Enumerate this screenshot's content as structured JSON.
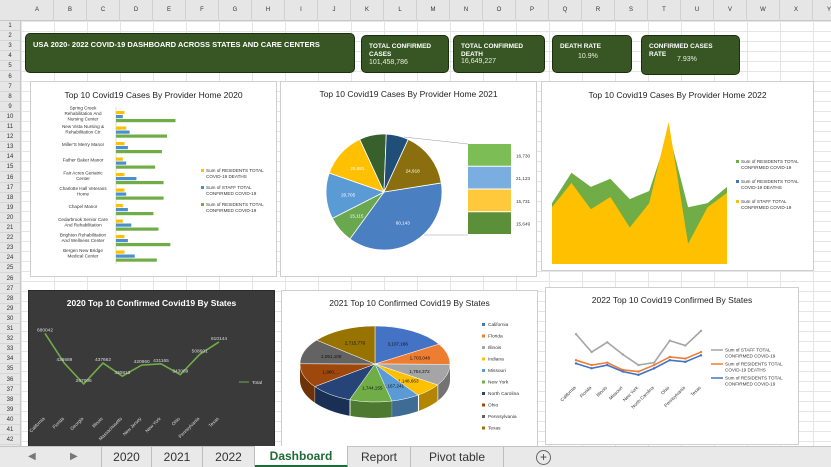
{
  "columns": [
    "A",
    "B",
    "C",
    "D",
    "E",
    "F",
    "G",
    "H",
    "I",
    "J",
    "K",
    "L",
    "M",
    "N",
    "O",
    "P",
    "Q",
    "R",
    "S",
    "T",
    "U",
    "V",
    "W",
    "X",
    "Y"
  ],
  "rows": [
    "1",
    "2",
    "3",
    "4",
    "5",
    "6",
    "7",
    "8",
    "9",
    "10",
    "11",
    "12",
    "13",
    "14",
    "15",
    "16",
    "17",
    "18",
    "19",
    "20",
    "21",
    "22",
    "23",
    "24",
    "25",
    "26",
    "27",
    "28",
    "29",
    "30",
    "31",
    "32",
    "33",
    "34",
    "35",
    "36",
    "37",
    "38",
    "39",
    "40",
    "41",
    "42"
  ],
  "banner": {
    "title": "USA 2020- 2022 COVID-19 DASHBOARD ACROSS STATES AND CARE CENTERS"
  },
  "kpis": [
    {
      "label": "TOTAL  CONFIRMED CASES",
      "value": "101,458,786"
    },
    {
      "label": "TOTAL  CONFIRMED DEATH",
      "value": "16,649,227"
    },
    {
      "label": "DEATH RATE",
      "value": "10.9%"
    },
    {
      "label": "CONFIRMED CASES RATE",
      "value": "7.93%"
    }
  ],
  "panels": {
    "p2020": {
      "title": "Top 10 Covid19 Cases By Provider Home 2020"
    },
    "p2021": {
      "title": "Top 10 Covid19 Cases By Provider Home 2021"
    },
    "p2022": {
      "title": "Top 10 Covid19 Cases By Provider Home 2022"
    },
    "s2020": {
      "title": "2020 Top 10 Confirmed Covid19 By States"
    },
    "s2021": {
      "title": "2021 Top 10 Confirmed Covid19 By States"
    },
    "s2022": {
      "title": "2022 Top 10 Covid19 Confirmed By States"
    }
  },
  "chart_data": [
    {
      "type": "bar",
      "title": "Top 10 Covid19 Cases By Provider Home 2020",
      "categories": [
        "Spring Creek Rehabilitation And Nursing Center",
        "New Vista Nursing & Rehabilitation Ctr",
        "Miller'S Merry Manor",
        "Father Baker Manor",
        "Fair Acres Geriatric Center",
        "Charlotte Hall Veterans Home",
        "Chapel Manor",
        "Cedarbrook Senior Care And Rehabilitation",
        "Brighton Rehabilitation And Wellness Center",
        "Bergen New Bridge Medical Center"
      ],
      "series": [
        {
          "name": "Sum of RESIDENTS  TOTAL COVID-19 DEATHS",
          "color": "#ffc000",
          "values": [
            5,
            6,
            5,
            4,
            5,
            5,
            4,
            4,
            5,
            5
          ]
        },
        {
          "name": "Sum of STAFF  TOTAL CONFIRMED COVID-19",
          "color": "#4a90d0",
          "values": [
            4,
            8,
            7,
            6,
            12,
            6,
            7,
            9,
            7,
            11
          ]
        },
        {
          "name": "Sum of RESIDENTS TOTAL CONFIRMED COVID-19",
          "color": "#70ad47",
          "values": [
            35,
            30,
            27,
            23,
            28,
            28,
            22,
            25,
            32,
            24
          ]
        }
      ]
    },
    {
      "type": "pie",
      "title": "Top 10 Covid19 Cases By Provider Home 2021",
      "slices": [
        {
          "value": 60000,
          "color": "#4a7fc1",
          "label": "60,143"
        },
        {
          "value": 12000,
          "color": "#6aa84f",
          "label": "15,115"
        },
        {
          "value": 20500,
          "color": "#5b9bd5",
          "label": "20,705"
        },
        {
          "value": 20500,
          "color": "#ffc000",
          "label": "20,681"
        },
        {
          "value": 12000,
          "color": "#38602c",
          "label": ""
        },
        {
          "value": 10000,
          "color": "#1f4e79",
          "label": ""
        },
        {
          "value": 25000,
          "color": "#8b6f0e",
          "label": "24,918"
        }
      ],
      "breakout": [
        {
          "value": 16730,
          "color": "#7cbd55",
          "label": "16,730"
        },
        {
          "value": 21123,
          "color": "#7aaee0",
          "label": "21,123"
        },
        {
          "value": 15731,
          "color": "#ffc93b",
          "label": "15,731"
        },
        {
          "value": 15649,
          "color": "#5b8f3a",
          "label": "15,649"
        }
      ]
    },
    {
      "type": "area",
      "title": "Top 10 Covid19 Cases By Provider Home 2022",
      "series": [
        {
          "name": "Sum of RESIDENTS TOTAL CONFIRMED COVID-19",
          "color": "#70ad47",
          "values": [
            30,
            45,
            38,
            42,
            32,
            36,
            65,
            28,
            30,
            38
          ]
        },
        {
          "name": "Sum of RESIDENTS  TOTAL COVID-19 DEATHS",
          "color": "#4472c4",
          "values": [
            0,
            0,
            0,
            0,
            0,
            0,
            0,
            0,
            0,
            0
          ]
        },
        {
          "name": "Sum of STAFF TOTAL CONFIRMED COVID-19",
          "color": "#ffc000",
          "values": [
            28,
            40,
            27,
            33,
            18,
            30,
            70,
            10,
            28,
            35
          ]
        }
      ]
    },
    {
      "type": "line",
      "title": "2020 Top 10 Confirmed Covid19 By States",
      "categories": [
        "California",
        "Florida",
        "Georgia",
        "Illinois",
        "Massachusetts",
        "New Jersey",
        "New York",
        "Ohio",
        "Pennsylvania",
        "Texas"
      ],
      "series": [
        {
          "name": "Total",
          "color": "#70ad47",
          "values": [
            680042,
            436689,
            267006,
            437662,
            330813,
            420960,
            431165,
            343089,
            508601,
            610144
          ]
        }
      ],
      "labels": [
        "680042",
        "436689",
        "267006",
        "437662",
        "330813",
        "420960",
        "431165",
        "343089",
        "508601",
        "610144"
      ]
    },
    {
      "type": "pie",
      "title": "2021 Top 10 Confirmed Covid19 By States",
      "slices": [
        {
          "name": "California",
          "value": 3107186,
          "color": "#4472c4",
          "label": "3,107,186"
        },
        {
          "name": "Florida",
          "value": 1703048,
          "color": "#ed7d31",
          "label": "1,703,048"
        },
        {
          "name": "Illinois",
          "value": 1754372,
          "color": "#a5a5a5",
          "label": "1,754,372"
        },
        {
          "name": "Indiana",
          "value": 1148663,
          "color": "#ffc000",
          "label": "1,148,663"
        },
        {
          "name": "Missouri",
          "value": 1167241,
          "color": "#5b9bd5",
          "label": "1,167,241"
        },
        {
          "name": "New York",
          "value": 1744155,
          "color": "#70ad47",
          "label": "1,744,155"
        },
        {
          "name": "North Carolina",
          "value": 1790000,
          "color": "#264478",
          "label": ""
        },
        {
          "name": "Ohio",
          "value": 1960000,
          "color": "#9e480e",
          "label": "1,960,..."
        },
        {
          "name": "Pennsylvania",
          "value": 2051108,
          "color": "#636363",
          "label": "2,051,108"
        },
        {
          "name": "Texas",
          "value": 2715776,
          "color": "#997300",
          "label": "2,715,776"
        }
      ]
    },
    {
      "type": "line",
      "title": "2022 Top 10 Covid19 Confirmed By States",
      "categories": [
        "California",
        "Florida",
        "Illinois",
        "Missouri",
        "New York",
        "North Carolina",
        "Ohio",
        "Pennsylvania",
        "Texas"
      ],
      "series": [
        {
          "name": "Sum of STAFF TOTAL CONFIRMED COVID-19",
          "color": "#a5a5a5",
          "values": [
            80,
            58,
            70,
            55,
            42,
            45,
            72,
            66,
            84
          ]
        },
        {
          "name": "Sum of RESIDENTS  TOTAL COVID-19 DEATHS",
          "color": "#ed7d31",
          "values": [
            48,
            42,
            45,
            36,
            34,
            42,
            52,
            50,
            58
          ]
        },
        {
          "name": "Sum of RESIDENTS  TOTAL CONFIRMED COVID-19",
          "color": "#4472c4",
          "values": [
            44,
            38,
            42,
            34,
            30,
            38,
            48,
            46,
            54
          ]
        }
      ]
    }
  ],
  "sheet_tabs": [
    "2020",
    "2021",
    "2022",
    "Dashboard",
    "Report",
    "Pivot table"
  ],
  "active_tab": "Dashboard",
  "add_sheet_label": "+"
}
